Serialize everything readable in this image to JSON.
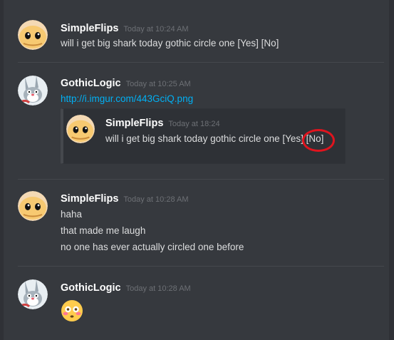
{
  "messages": [
    {
      "username": "SimpleFlips",
      "timestamp": "Today at 10:24 AM",
      "avatar": "face-avatar",
      "lines": [
        "will i get big shark today gothic circle one [Yes] [No]"
      ]
    },
    {
      "username": "GothicLogic",
      "timestamp": "Today at 10:25 AM",
      "avatar": "bugs-bunny-avatar",
      "link": "http://i.imgur.com/443GciQ.png",
      "embed": {
        "username": "SimpleFlips",
        "timestamp": "Today at 18:24",
        "text_before": "will i get big shark today gothic circle one [Yes] ",
        "circled": "[No]"
      }
    },
    {
      "username": "SimpleFlips",
      "timestamp": "Today at 10:28 AM",
      "avatar": "face-avatar",
      "lines": [
        "haha",
        "that made me laugh",
        "no one has ever actually circled one before"
      ]
    },
    {
      "username": "GothicLogic",
      "timestamp": "Today at 10:28 AM",
      "avatar": "bugs-bunny-avatar",
      "emoji": "flushed-face-emoji"
    }
  ],
  "colors": {
    "background": "#36393e",
    "link": "#00b0f4",
    "circle": "#e0141e"
  }
}
